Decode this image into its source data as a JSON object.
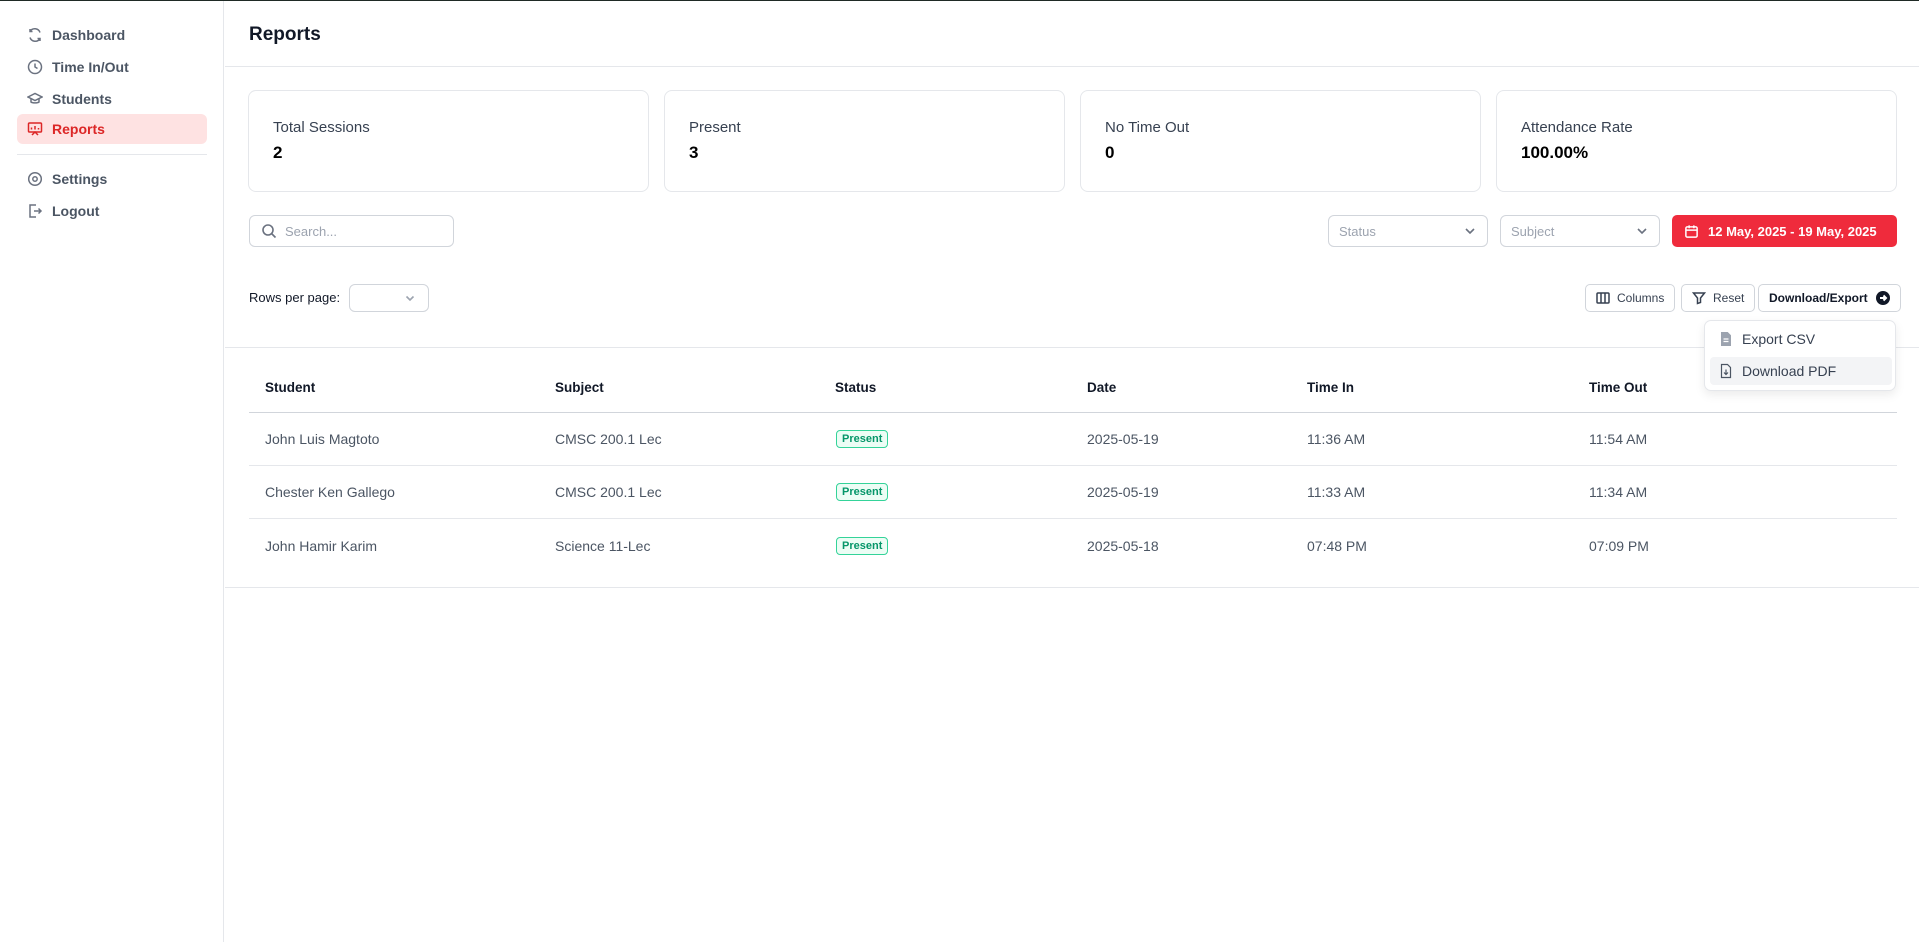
{
  "sidebar": {
    "items": [
      {
        "label": "Dashboard",
        "icon": "refresh-icon",
        "active": false
      },
      {
        "label": "Time In/Out",
        "icon": "clock-icon",
        "active": false
      },
      {
        "label": "Students",
        "icon": "graduation-cap-icon",
        "active": false
      },
      {
        "label": "Reports",
        "icon": "presentation-chart-icon",
        "active": true
      },
      {
        "label": "Settings",
        "icon": "gear-icon",
        "active": false
      },
      {
        "label": "Logout",
        "icon": "logout-icon",
        "active": false
      }
    ]
  },
  "header": {
    "title": "Reports"
  },
  "stats": [
    {
      "label": "Total Sessions",
      "value": "2"
    },
    {
      "label": "Present",
      "value": "3"
    },
    {
      "label": "No Time Out",
      "value": "0"
    },
    {
      "label": "Attendance Rate",
      "value": "100.00%"
    }
  ],
  "filters": {
    "search_placeholder": "Search...",
    "status_placeholder": "Status",
    "subject_placeholder": "Subject",
    "date_range": "12 May, 2025 - 19 May, 2025"
  },
  "toolbar": {
    "rows_per_page_label": "Rows per page:",
    "rows_per_page_value": "",
    "columns_label": "Columns",
    "reset_label": "Reset",
    "export_label": "Download/Export"
  },
  "export_menu": {
    "items": [
      {
        "label": "Export CSV",
        "icon": "file-text-icon"
      },
      {
        "label": "Download PDF",
        "icon": "file-download-icon"
      }
    ]
  },
  "table": {
    "columns": [
      "Student",
      "Subject",
      "Status",
      "Date",
      "Time In",
      "Time Out"
    ],
    "rows": [
      {
        "student": "John Luis Magtoto",
        "subject": "CMSC 200.1 Lec",
        "status": "Present",
        "date": "2025-05-19",
        "time_in": "11:36 AM",
        "time_out": "11:54 AM"
      },
      {
        "student": "Chester Ken Gallego",
        "subject": "CMSC 200.1 Lec",
        "status": "Present",
        "date": "2025-05-19",
        "time_in": "11:33 AM",
        "time_out": "11:34 AM"
      },
      {
        "student": "John Hamir Karim",
        "subject": "Science 11-Lec",
        "status": "Present",
        "date": "2025-05-18",
        "time_in": "07:48 PM",
        "time_out": "07:09 PM"
      }
    ]
  },
  "colors": {
    "accent": "#ef2b3c",
    "active_nav_bg": "#fee2e2",
    "active_nav_text": "#dc2626",
    "status_present": "#059669"
  }
}
